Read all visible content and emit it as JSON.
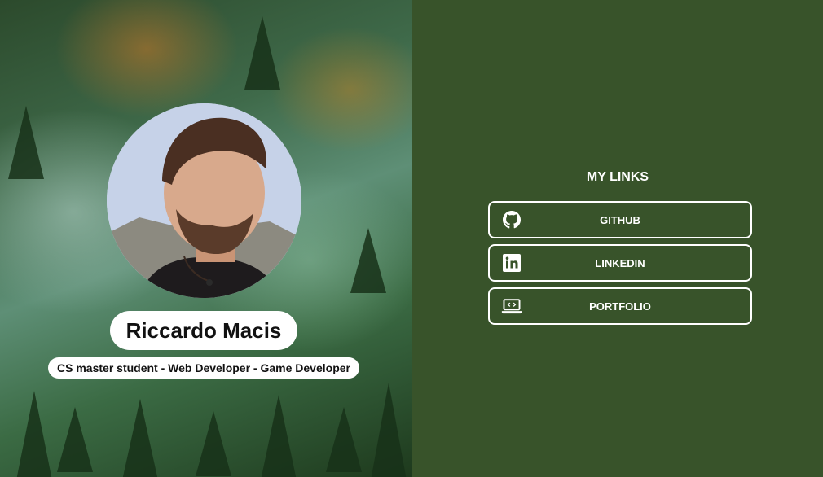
{
  "profile": {
    "name": "Riccardo Macis",
    "subtitle": "CS master student - Web Developer - Game Developer"
  },
  "links": {
    "title": "MY LINKS",
    "items": [
      {
        "label": "GITHUB",
        "icon": "github-icon"
      },
      {
        "label": "LINKEDIN",
        "icon": "linkedin-icon"
      },
      {
        "label": "PORTFOLIO",
        "icon": "laptop-code-icon"
      }
    ]
  },
  "colors": {
    "right_panel_bg": "#38532a",
    "button_border": "#ffffff",
    "text_light": "#ffffff",
    "pill_bg": "#ffffff",
    "pill_text": "#111111"
  }
}
